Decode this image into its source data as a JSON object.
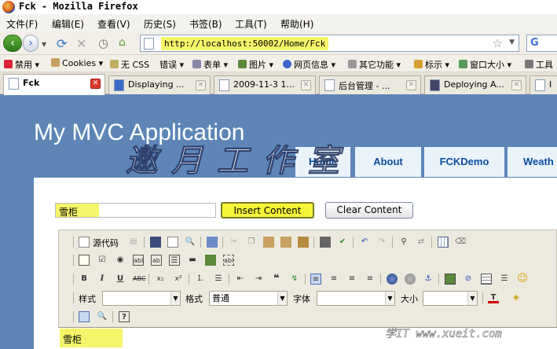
{
  "window": {
    "title": "Fck - Mozilla Firefox"
  },
  "menu": [
    "文件(F)",
    "编辑(E)",
    "查看(V)",
    "历史(S)",
    "书签(B)",
    "工具(T)",
    "帮助(H)"
  ],
  "nav": {
    "url": "http://localhost:50002/Home/Fck",
    "back": "‹",
    "forward": "›",
    "search_engine_icon": "G"
  },
  "toolbar": [
    "禁用",
    "Cookies",
    "无 CSS",
    "错误",
    "表单",
    "图片",
    "网页信息",
    "其它功能",
    "标示",
    "窗口大小",
    "工具"
  ],
  "tabs": [
    {
      "label": "Fck",
      "active": true
    },
    {
      "label": "Displaying ...",
      "active": false
    },
    {
      "label": "2009-11-3 1...",
      "active": false
    },
    {
      "label": "后台管理 - ...",
      "active": false
    },
    {
      "label": "Deploying A...",
      "active": false
    },
    {
      "label": "I",
      "active": false
    }
  ],
  "page": {
    "app_title": "My MVC Application",
    "site_tabs": [
      "Home",
      "About",
      "FCKDemo",
      "Weath"
    ],
    "watermark": "邀月工作室",
    "input_value": "雪柜",
    "insert_button": "Insert Content",
    "clear_button": "Clear Content"
  },
  "editor": {
    "source_label": "源代码",
    "style_label": "样式",
    "format_label": "格式",
    "format_value": "普通",
    "font_label": "字体",
    "size_label": "大小",
    "content": "雪柜"
  },
  "footer": {
    "site": "学IT www.xueit.com"
  },
  "colors": {
    "url_highlight": "#f5f56a",
    "insert_button": "#f5f53a",
    "page_bg": "#5d86b7",
    "site_tab_text": "#0a4c9e"
  }
}
